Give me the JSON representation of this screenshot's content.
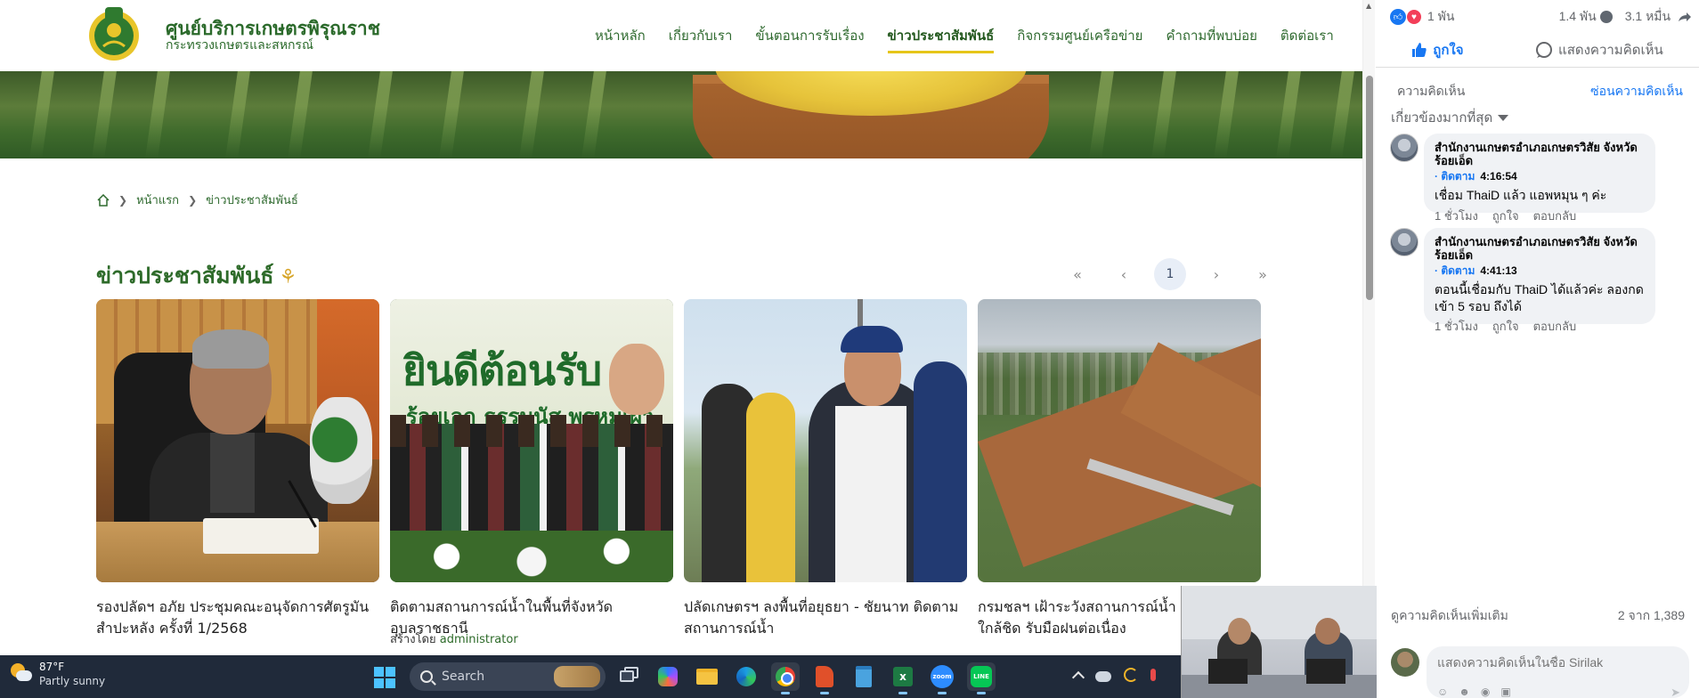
{
  "site": {
    "brand_title": "ศูนย์บริการเกษตรพิรุณราช",
    "brand_subtitle": "กระทรวงเกษตรและสหกรณ์",
    "nav": [
      {
        "label": "หน้าหลัก",
        "active": false
      },
      {
        "label": "เกี่ยวกับเรา",
        "active": false
      },
      {
        "label": "ขั้นตอนการรับเรื่อง",
        "active": false
      },
      {
        "label": "ข่าวประชาสัมพันธ์",
        "active": true
      },
      {
        "label": "กิจกรรมศูนย์เครือข่าย",
        "active": false
      },
      {
        "label": "คำถามที่พบบ่อย",
        "active": false
      },
      {
        "label": "ติดต่อเรา",
        "active": false
      }
    ],
    "breadcrumb": [
      "หน้าแรก",
      "ข่าวประชาสัมพันธ์"
    ],
    "section_title": "ข่าวประชาสัมพันธ์",
    "pager": {
      "first": "«",
      "prev": "‹",
      "current": "1",
      "next": "›",
      "last": "»"
    },
    "cards": [
      {
        "title": "รองปลัดฯ อภัย ประชุมคณะอนุจัดการศัตรูมันสำปะหลัง ครั้งที่ 1/2568"
      },
      {
        "title": "ติดตามสถานการณ์น้ำในพื้นที่จังหวัดอุบลราชธานี",
        "author_label": "สร้างโดย",
        "author": "administrator",
        "banner_text1": "ยินดีต้อนรับ",
        "banner_text2": "ร้อยเอก ธรรมนัส พรหมเผ่า"
      },
      {
        "title": "ปลัดเกษตรฯ ลงพื้นที่อยุธยา - ชัยนาท ติดตามสถานการณ์น้ำ"
      },
      {
        "title": "กรมชลฯ เฝ้าระวังสถานการณ์น้ำใกล้ชิด รับมือฝนต่อเนื่อง"
      }
    ],
    "accent_color": "#2e6b2a",
    "active_underline_color": "#e6c619"
  },
  "fb": {
    "likes": "1 พัน",
    "comments_count": "1.4 พัน",
    "shares_count": "3.1 หมื่น",
    "like_label": "ถูกใจ",
    "comment_label": "แสดงความคิดเห็น",
    "comments_header": "ความคิดเห็น",
    "hide_comments": "ซ่อนความคิดเห็น",
    "sort_label": "เกี่ยวข้องมากที่สุด",
    "comments": [
      {
        "name": "สำนักงานเกษตรอำเภอเกษตรวิสัย จังหวัดร้อยเอ็ด",
        "follow": "· ติดตาม",
        "time": "4:16:54",
        "text": "เชื่อม ThaiD แล้ว แอพหมุน ๆ ค่ะ",
        "age": "1 ชั่วโมง",
        "like": "ถูกใจ",
        "reply": "ตอบกลับ"
      },
      {
        "name": "สำนักงานเกษตรอำเภอเกษตรวิสัย จังหวัดร้อยเอ็ด",
        "follow": "· ติดตาม",
        "time": "4:41:13",
        "text": "ตอนนี้เชื่อมกับ ThaiD ได้แล้วค่ะ ลองกดเข้า 5 รอบ ถึงได้",
        "age": "1 ชั่วโมง",
        "like": "ถูกใจ",
        "reply": "ตอบกลับ"
      }
    ],
    "more_comments": "ดูความคิดเห็นเพิ่มเติม",
    "comment_range": "2 จาก 1,389",
    "composer_placeholder": "แสดงความคิดเห็นในชื่อ Sirilak",
    "like_color": "#1877f2"
  },
  "taskbar": {
    "weather_temp": "87°F",
    "weather_desc": "Partly sunny",
    "search_label": "Search",
    "excel_letter": "x",
    "zoom_label": "zoom",
    "line_label": "LINE"
  }
}
